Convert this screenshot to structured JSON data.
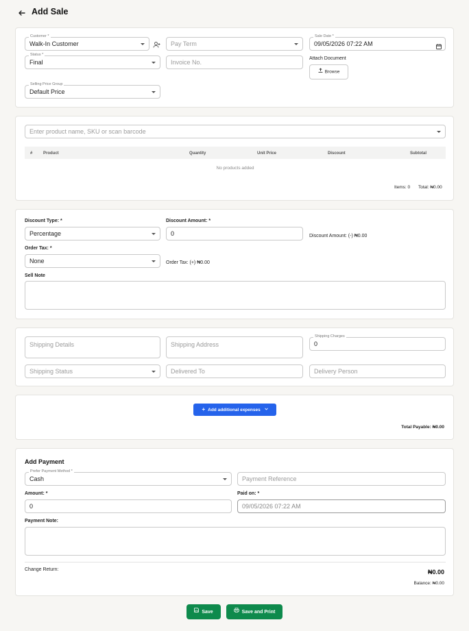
{
  "page_title": "Add Sale",
  "sale_info": {
    "customer_label": "Customer *",
    "customer_value": "Walk-In Customer",
    "pay_term_placeholder": "Pay Term",
    "sale_date_label": "Sale Date *",
    "sale_date_value": "09/05/2026 07:22 AM",
    "status_label": "Status *",
    "status_value": "Final",
    "invoice_placeholder": "Invoice No.",
    "attach_document_label": "Attach Document",
    "browse_label": "Browse",
    "price_group_label": "Selling Price Group",
    "price_group_value": "Default Price"
  },
  "products": {
    "search_placeholder": "Enter product name, SKU or scan barcode",
    "columns": [
      "#",
      "Product",
      "Quantity",
      "Unit Price",
      "Discount",
      "Subtotal"
    ],
    "empty_text": "No products added",
    "items_text": "Items: 0",
    "total_text": "Total: ₦0.00"
  },
  "discount": {
    "type_label": "Discount Type: *",
    "type_value": "Percentage",
    "amount_label": "Discount Amount: *",
    "amount_value": "0",
    "amount_summary": "Discount Amount: (-) ₦0.00",
    "tax_label": "Order Tax: *",
    "tax_value": "None",
    "tax_summary": "Order Tax: (+) ₦0.00",
    "sell_note_label": "Sell Note"
  },
  "shipping": {
    "details_placeholder": "Shipping Details",
    "address_placeholder": "Shipping Address",
    "charges_label": "Shipping Charges",
    "charges_value": "0",
    "status_placeholder": "Shipping Status",
    "delivered_to_placeholder": "Delivered To",
    "delivery_person_placeholder": "Delivery Person"
  },
  "expenses": {
    "button_label": "Add additional expenses",
    "total_payable": "Total Payable: ₦0.00"
  },
  "payment": {
    "heading": "Add Payment",
    "method_label": "Prefer Payment Method *",
    "method_value": "Cash",
    "reference_placeholder": "Payment Reference",
    "amount_label": "Amount: *",
    "amount_value": "0",
    "paid_on_label": "Paid on: *",
    "paid_on_value": "09/05/2026 07:22 AM",
    "note_label": "Payment Note:",
    "change_return_label": "Change Return:",
    "change_return_value": "₦0.00",
    "balance_text": "Balance: ₦0.00"
  },
  "actions": {
    "save_label": "Save",
    "save_print_label": "Save and Print"
  }
}
